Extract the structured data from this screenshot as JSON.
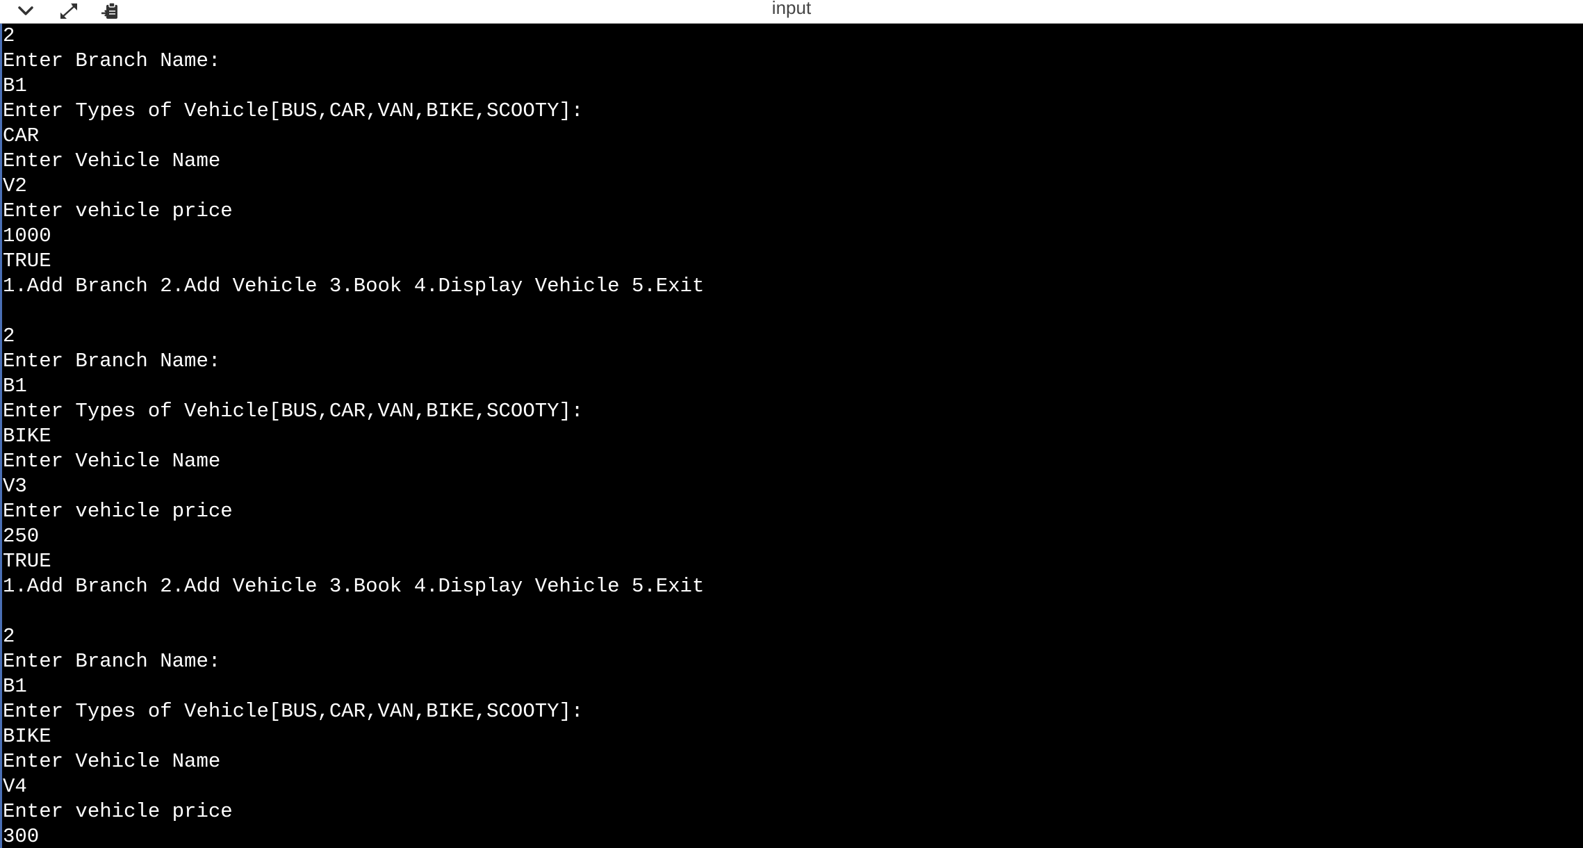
{
  "window": {
    "title": "input"
  },
  "toolbar": {
    "collapse_icon": "chevron-down-icon",
    "expand_icon": "expand-arrows-icon",
    "clipboard_icon": "clipboard-paste-icon"
  },
  "console": {
    "lines": [
      "2",
      "Enter Branch Name:",
      "B1",
      "Enter Types of Vehicle[BUS,CAR,VAN,BIKE,SCOOTY]:",
      "CAR",
      "Enter Vehicle Name",
      "V2",
      "Enter vehicle price",
      "1000",
      "TRUE",
      "1.Add Branch 2.Add Vehicle 3.Book 4.Display Vehicle 5.Exit",
      "",
      "2",
      "Enter Branch Name:",
      "B1",
      "Enter Types of Vehicle[BUS,CAR,VAN,BIKE,SCOOTY]:",
      "BIKE",
      "Enter Vehicle Name",
      "V3",
      "Enter vehicle price",
      "250",
      "TRUE",
      "1.Add Branch 2.Add Vehicle 3.Book 4.Display Vehicle 5.Exit",
      "",
      "2",
      "Enter Branch Name:",
      "B1",
      "Enter Types of Vehicle[BUS,CAR,VAN,BIKE,SCOOTY]:",
      "BIKE",
      "Enter Vehicle Name",
      "V4",
      "Enter vehicle price",
      "300"
    ]
  },
  "colors": {
    "background": "#000000",
    "text": "#ffffff",
    "titlebar": "#ffffff",
    "title_text": "#444444",
    "left_edge": "#4a6fb5"
  }
}
